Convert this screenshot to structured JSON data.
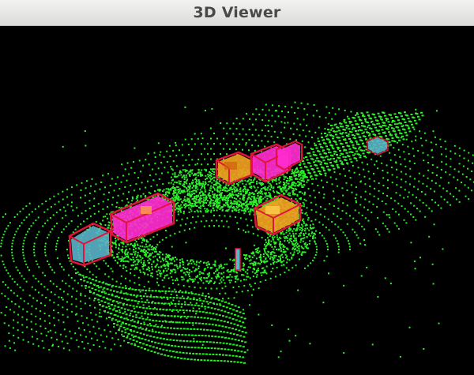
{
  "window": {
    "title": "3D Viewer"
  },
  "scene": {
    "background": "#000000",
    "point_color": "#2cf02a",
    "box_edge_color": "#e2143c",
    "object_classes": [
      {
        "name": "car",
        "colors": [
          "#ff2bd0",
          "#f0a020",
          "#5ab4c8"
        ]
      },
      {
        "name": "pedestrian",
        "colors": [
          "#e2143c"
        ]
      }
    ]
  }
}
